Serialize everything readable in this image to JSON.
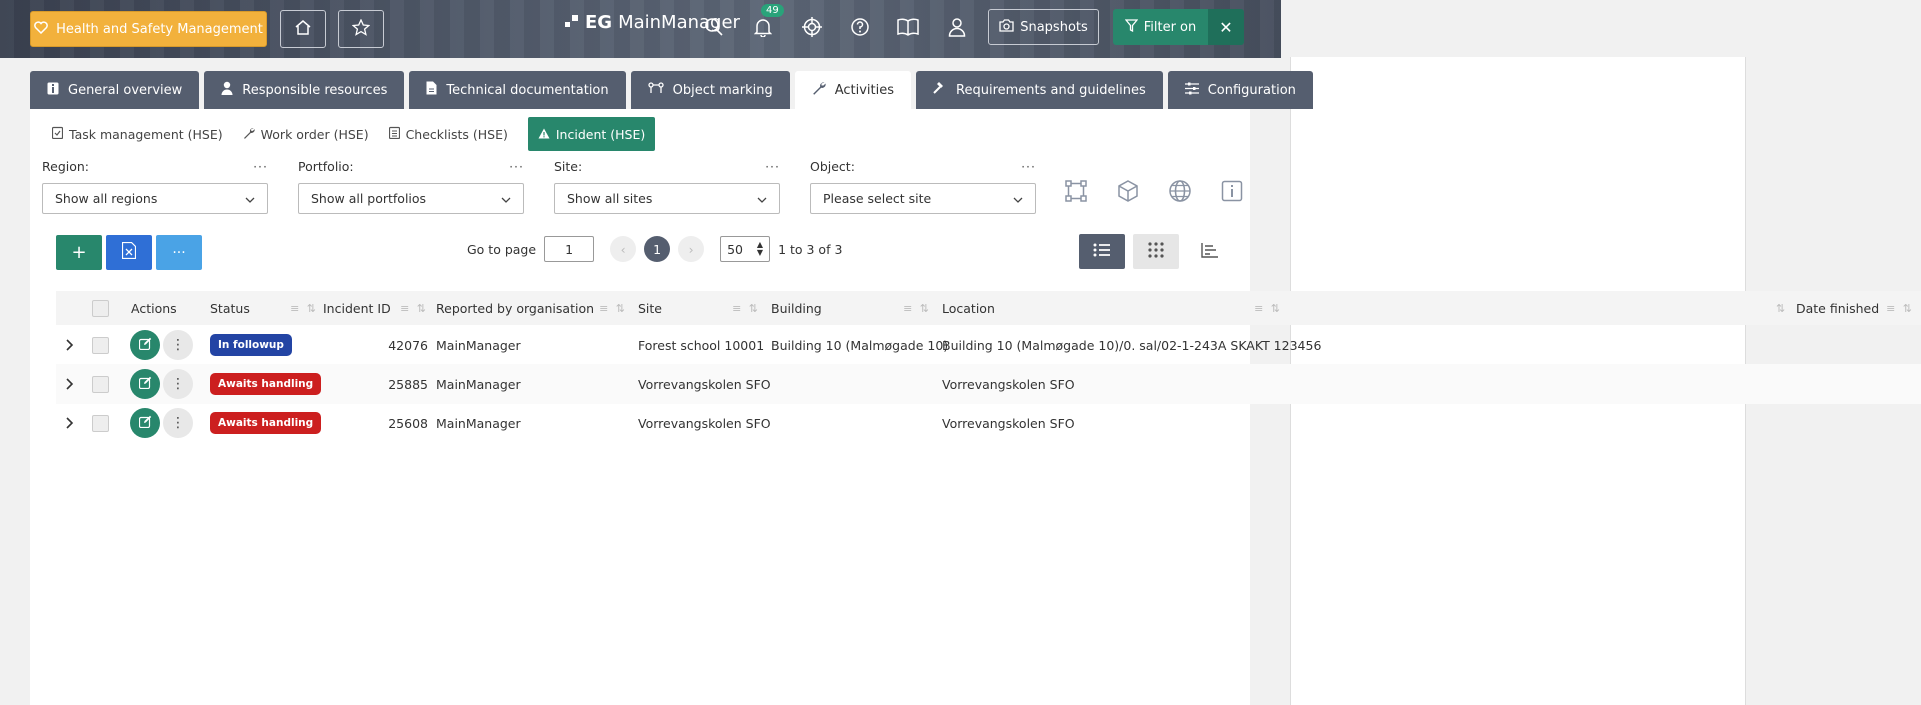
{
  "header": {
    "module_button": "Health and Safety Management",
    "logo_prefix": "EG",
    "logo_name": "MainManager",
    "notifications_count": "49",
    "snapshots_label": "Snapshots",
    "filter_label": "Filter on"
  },
  "tabs": [
    {
      "label": "General overview",
      "icon": "info-icon"
    },
    {
      "label": "Responsible resources",
      "icon": "person-icon"
    },
    {
      "label": "Technical documentation",
      "icon": "document-icon"
    },
    {
      "label": "Object marking",
      "icon": "marking-icon"
    },
    {
      "label": "Activities",
      "icon": "wrench-icon",
      "active": true
    },
    {
      "label": "Requirements and guidelines",
      "icon": "gavel-icon"
    },
    {
      "label": "Configuration",
      "icon": "sliders-icon"
    }
  ],
  "subtabs": [
    {
      "label": "Task management (HSE)"
    },
    {
      "label": "Work order (HSE)"
    },
    {
      "label": "Checklists (HSE)"
    },
    {
      "label": "Incident (HSE)",
      "active": true
    }
  ],
  "filters": [
    {
      "label": "Region:",
      "value": "Show all regions"
    },
    {
      "label": "Portfolio:",
      "value": "Show all portfolios"
    },
    {
      "label": "Site:",
      "value": "Show all sites"
    },
    {
      "label": "Object:",
      "value": "Please select site"
    }
  ],
  "pager": {
    "go_to_label": "Go to page",
    "page_input": "1",
    "current_page": "1",
    "page_size": "50",
    "range_text": "1 to 3 of 3"
  },
  "table": {
    "headers": {
      "actions": "Actions",
      "status": "Status",
      "incident_id": "Incident ID",
      "reported_by": "Reported by organisation",
      "site": "Site",
      "building": "Building",
      "location": "Location",
      "date_finished": "Date finished"
    },
    "rows": [
      {
        "status": "In followup",
        "status_color": "#2344a4",
        "incident_id": "42076",
        "reported_by": "MainManager",
        "site": "Forest school 10001",
        "building": "Building 10 (Malmøgade 10)",
        "location": "Building 10 (Malmøgade 10)/0. sal/02-1-243A SKAKT 123456"
      },
      {
        "status": "Awaits handling",
        "status_color": "#cc1f1f",
        "incident_id": "25885",
        "reported_by": "MainManager",
        "site": "Vorrevangskolen SFO",
        "building": "",
        "location": "Vorrevangskolen SFO"
      },
      {
        "status": "Awaits handling",
        "status_color": "#cc1f1f",
        "incident_id": "25608",
        "reported_by": "MainManager",
        "site": "Vorrevangskolen SFO",
        "building": "",
        "location": "Vorrevangskolen SFO"
      }
    ]
  }
}
